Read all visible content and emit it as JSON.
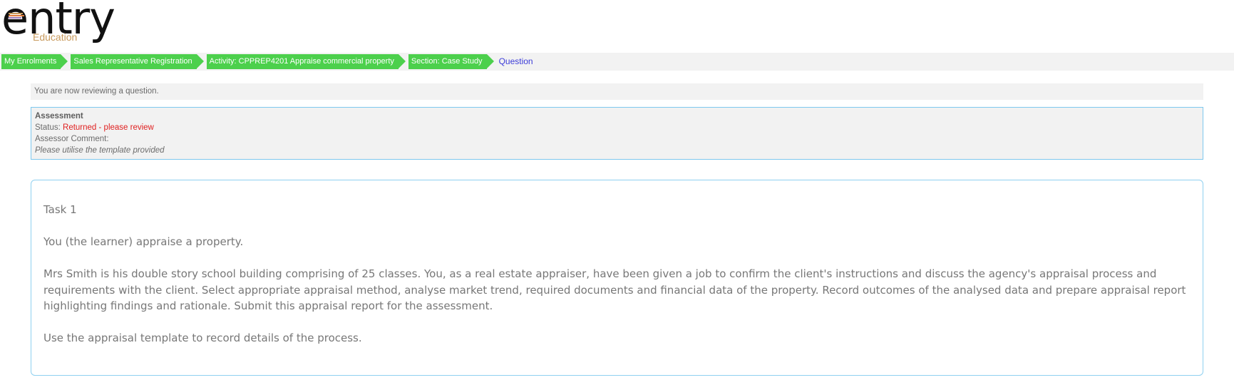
{
  "logo": {
    "word": "entry",
    "sub": "Education",
    "mark_colors": [
      "#c89a5c",
      "#e07b3a",
      "#9b7bb8"
    ]
  },
  "breadcrumb": {
    "items": [
      {
        "label": "My Enrolments"
      },
      {
        "label": "Sales Representative Registration"
      },
      {
        "label": "Activity: CPPREP4201 Appraise commercial property"
      },
      {
        "label": "Section: Case Study"
      }
    ],
    "current": "Question"
  },
  "notice": {
    "text": "You are now reviewing a question."
  },
  "assessment": {
    "heading": "Assessment",
    "status_label": "Status:",
    "status_value": "Returned - please review",
    "comment_label": "Assessor Comment:",
    "comment_text": "Please utilise the template provided"
  },
  "question": {
    "task_title": "Task 1",
    "intro": "You (the learner) appraise a property.",
    "scenario": "Mrs Smith is his double story school building comprising of 25 classes. You, as a real estate appraiser, have been given a job to confirm the client's instructions and discuss the agency's appraisal process and requirements with the client. Select appropriate appraisal method, analyse market trend, required documents and financial data of the property. Record outcomes of the analysed data and prepare appraisal report highlighting findings and rationale. Submit this appraisal report for the assessment.",
    "instruction": "Use the appraisal template to record details of the process."
  },
  "colors": {
    "breadcrumb_green": "#4cd04c",
    "current_crumb": "#3c3cd8",
    "status_red": "#e02020",
    "border_blue": "#8fd0f0"
  }
}
